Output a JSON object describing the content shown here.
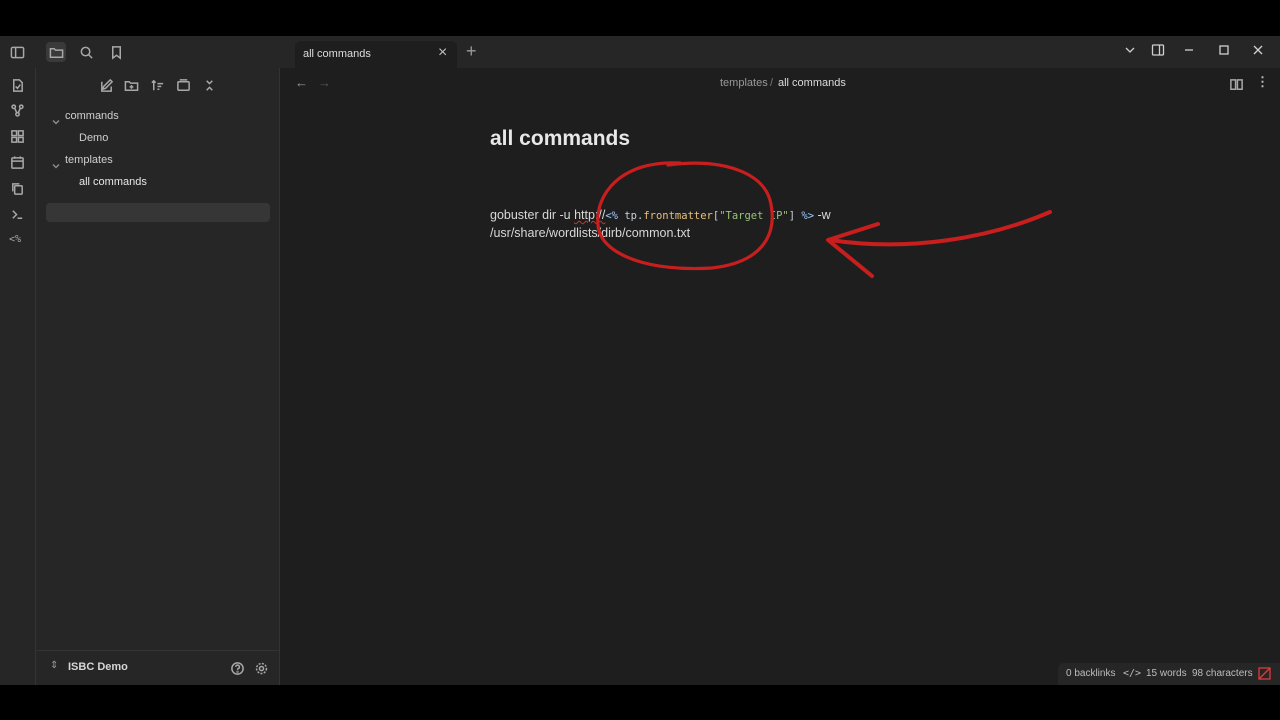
{
  "tab": {
    "title": "all commands",
    "close": "×",
    "new": "+"
  },
  "breadcrumb": {
    "folder": "templates",
    "sep": "/",
    "file": "all commands"
  },
  "sidebar": {
    "tree": [
      {
        "label": "commands",
        "type": "folder"
      },
      {
        "label": "Demo",
        "type": "file"
      },
      {
        "label": "templates",
        "type": "folder"
      },
      {
        "label": "all commands",
        "type": "file",
        "selected": true
      }
    ],
    "vault_name": "ISBC Demo"
  },
  "document": {
    "title": "all commands",
    "line1_prefix": "gobuster dir -u ",
    "line1_http": "http://",
    "tpl_open": "<%",
    "tpl_obj": " tp.",
    "tpl_prop": "frontmatter",
    "tpl_br_open": "[",
    "tpl_str": "\"Target IP\"",
    "tpl_br_close": "] ",
    "tpl_close": "%>",
    "line1_suffix": " -w",
    "line2": "/usr/share/wordlists/dirb/common.txt"
  },
  "statusbar": {
    "backlinks": "0 backlinks",
    "code_icon": "</>",
    "words": "15 words",
    "characters": "98 characters"
  },
  "ribbon_icons": [
    "open-quick-switcher-icon",
    "graph-view-icon",
    "canvas-icon",
    "daily-notes-icon",
    "copy-icon",
    "command-palette-icon",
    "templater-icon"
  ],
  "colors": {
    "accent_annotation": "#c81e1e",
    "background": "#1e1e1e",
    "sidebar": "#262626"
  }
}
